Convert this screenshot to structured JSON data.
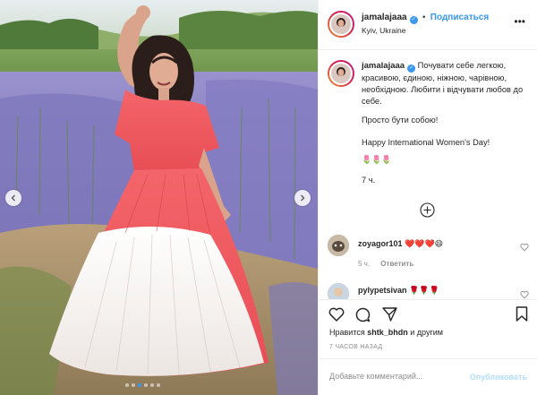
{
  "header": {
    "username": "jamalajaaa",
    "follow_label": "Подписаться",
    "dot": "•",
    "location": "Kyiv, Ukraine",
    "more": "•••"
  },
  "caption": {
    "username": "jamalajaaa",
    "line1": "Почувати себе легкою, красивою, єдиною, ніжною, чарівною, необхідною. Любити і відчувати любов до себе.",
    "line2": "Просто бути собою!",
    "line3": "Happy International Women's Day!",
    "emojis": "🌷🌷🌷",
    "time": "7 ч."
  },
  "comments": [
    {
      "username": "zoyagor101",
      "text": "❤️❤️❤️😄",
      "time": "5 ч.",
      "reply_label": "Ответить"
    },
    {
      "username": "pylypetsivan",
      "text": "🌹🌹🌹"
    }
  ],
  "likes": {
    "prefix": "Нравится",
    "user": "shtk_bhdn",
    "suffix": "и другим"
  },
  "ago": "7 ЧАСОВ НАЗАД",
  "add_comment": {
    "placeholder": "Добавьте комментарий...",
    "publish_label": "Опубликовать"
  },
  "colors": {
    "accent": "#3897f0",
    "dress": "#f0575e",
    "lavender": "#8f86c9",
    "grass": "#6f9a3c"
  },
  "icons": [
    "chevron-left-icon",
    "chevron-right-icon",
    "heart-icon",
    "comment-icon",
    "share-icon",
    "bookmark-icon",
    "plus-circle-icon",
    "verified-icon"
  ]
}
